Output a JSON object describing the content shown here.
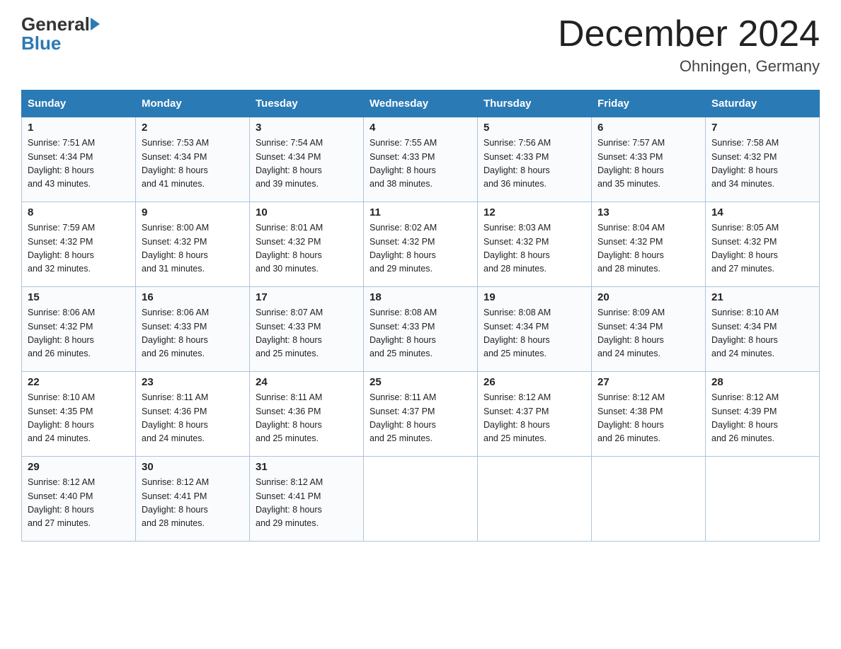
{
  "header": {
    "title": "December 2024",
    "location": "Ohningen, Germany",
    "logo_general": "General",
    "logo_blue": "Blue"
  },
  "days_of_week": [
    "Sunday",
    "Monday",
    "Tuesday",
    "Wednesday",
    "Thursday",
    "Friday",
    "Saturday"
  ],
  "weeks": [
    [
      {
        "day": "1",
        "sunrise": "7:51 AM",
        "sunset": "4:34 PM",
        "daylight": "8 hours and 43 minutes."
      },
      {
        "day": "2",
        "sunrise": "7:53 AM",
        "sunset": "4:34 PM",
        "daylight": "8 hours and 41 minutes."
      },
      {
        "day": "3",
        "sunrise": "7:54 AM",
        "sunset": "4:34 PM",
        "daylight": "8 hours and 39 minutes."
      },
      {
        "day": "4",
        "sunrise": "7:55 AM",
        "sunset": "4:33 PM",
        "daylight": "8 hours and 38 minutes."
      },
      {
        "day": "5",
        "sunrise": "7:56 AM",
        "sunset": "4:33 PM",
        "daylight": "8 hours and 36 minutes."
      },
      {
        "day": "6",
        "sunrise": "7:57 AM",
        "sunset": "4:33 PM",
        "daylight": "8 hours and 35 minutes."
      },
      {
        "day": "7",
        "sunrise": "7:58 AM",
        "sunset": "4:32 PM",
        "daylight": "8 hours and 34 minutes."
      }
    ],
    [
      {
        "day": "8",
        "sunrise": "7:59 AM",
        "sunset": "4:32 PM",
        "daylight": "8 hours and 32 minutes."
      },
      {
        "day": "9",
        "sunrise": "8:00 AM",
        "sunset": "4:32 PM",
        "daylight": "8 hours and 31 minutes."
      },
      {
        "day": "10",
        "sunrise": "8:01 AM",
        "sunset": "4:32 PM",
        "daylight": "8 hours and 30 minutes."
      },
      {
        "day": "11",
        "sunrise": "8:02 AM",
        "sunset": "4:32 PM",
        "daylight": "8 hours and 29 minutes."
      },
      {
        "day": "12",
        "sunrise": "8:03 AM",
        "sunset": "4:32 PM",
        "daylight": "8 hours and 28 minutes."
      },
      {
        "day": "13",
        "sunrise": "8:04 AM",
        "sunset": "4:32 PM",
        "daylight": "8 hours and 28 minutes."
      },
      {
        "day": "14",
        "sunrise": "8:05 AM",
        "sunset": "4:32 PM",
        "daylight": "8 hours and 27 minutes."
      }
    ],
    [
      {
        "day": "15",
        "sunrise": "8:06 AM",
        "sunset": "4:32 PM",
        "daylight": "8 hours and 26 minutes."
      },
      {
        "day": "16",
        "sunrise": "8:06 AM",
        "sunset": "4:33 PM",
        "daylight": "8 hours and 26 minutes."
      },
      {
        "day": "17",
        "sunrise": "8:07 AM",
        "sunset": "4:33 PM",
        "daylight": "8 hours and 25 minutes."
      },
      {
        "day": "18",
        "sunrise": "8:08 AM",
        "sunset": "4:33 PM",
        "daylight": "8 hours and 25 minutes."
      },
      {
        "day": "19",
        "sunrise": "8:08 AM",
        "sunset": "4:34 PM",
        "daylight": "8 hours and 25 minutes."
      },
      {
        "day": "20",
        "sunrise": "8:09 AM",
        "sunset": "4:34 PM",
        "daylight": "8 hours and 24 minutes."
      },
      {
        "day": "21",
        "sunrise": "8:10 AM",
        "sunset": "4:34 PM",
        "daylight": "8 hours and 24 minutes."
      }
    ],
    [
      {
        "day": "22",
        "sunrise": "8:10 AM",
        "sunset": "4:35 PM",
        "daylight": "8 hours and 24 minutes."
      },
      {
        "day": "23",
        "sunrise": "8:11 AM",
        "sunset": "4:36 PM",
        "daylight": "8 hours and 24 minutes."
      },
      {
        "day": "24",
        "sunrise": "8:11 AM",
        "sunset": "4:36 PM",
        "daylight": "8 hours and 25 minutes."
      },
      {
        "day": "25",
        "sunrise": "8:11 AM",
        "sunset": "4:37 PM",
        "daylight": "8 hours and 25 minutes."
      },
      {
        "day": "26",
        "sunrise": "8:12 AM",
        "sunset": "4:37 PM",
        "daylight": "8 hours and 25 minutes."
      },
      {
        "day": "27",
        "sunrise": "8:12 AM",
        "sunset": "4:38 PM",
        "daylight": "8 hours and 26 minutes."
      },
      {
        "day": "28",
        "sunrise": "8:12 AM",
        "sunset": "4:39 PM",
        "daylight": "8 hours and 26 minutes."
      }
    ],
    [
      {
        "day": "29",
        "sunrise": "8:12 AM",
        "sunset": "4:40 PM",
        "daylight": "8 hours and 27 minutes."
      },
      {
        "day": "30",
        "sunrise": "8:12 AM",
        "sunset": "4:41 PM",
        "daylight": "8 hours and 28 minutes."
      },
      {
        "day": "31",
        "sunrise": "8:12 AM",
        "sunset": "4:41 PM",
        "daylight": "8 hours and 29 minutes."
      },
      null,
      null,
      null,
      null
    ]
  ],
  "labels": {
    "sunrise": "Sunrise:",
    "sunset": "Sunset:",
    "daylight": "Daylight:"
  }
}
